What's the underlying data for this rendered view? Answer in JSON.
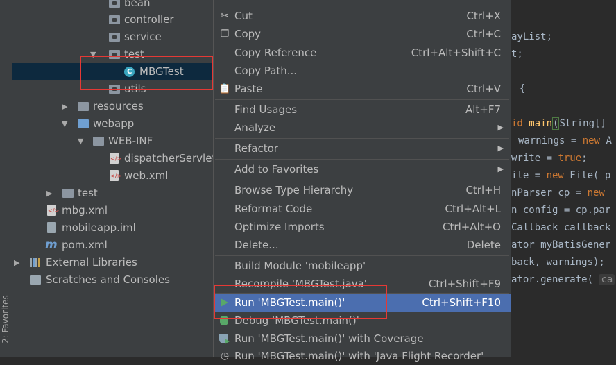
{
  "sidebar": {
    "favorites_label": "2: Favorites"
  },
  "tree": {
    "bean": "bean",
    "controller": "controller",
    "service": "service",
    "test": "test",
    "mbgtest": "MBGTest",
    "utils": "utils",
    "resources": "resources",
    "webapp": "webapp",
    "webinf": "WEB-INF",
    "dispatcher": "dispatcherServlet",
    "webxml": "web.xml",
    "test2": "test",
    "mbgxml": "mbg.xml",
    "iml": "mobileapp.iml",
    "pom": "pom.xml",
    "extlibs": "External Libraries",
    "scratches": "Scratches and Consoles"
  },
  "menu": {
    "cut": "Cut",
    "cut_sc": "Ctrl+X",
    "copy": "Copy",
    "copy_sc": "Ctrl+C",
    "copy_ref": "Copy Reference",
    "copy_ref_sc": "Ctrl+Alt+Shift+C",
    "copy_path": "Copy Path...",
    "paste": "Paste",
    "paste_sc": "Ctrl+V",
    "find_usages": "Find Usages",
    "find_usages_sc": "Alt+F7",
    "analyze": "Analyze",
    "refactor": "Refactor",
    "add_fav": "Add to Favorites",
    "browse_type": "Browse Type Hierarchy",
    "browse_type_sc": "Ctrl+H",
    "reformat": "Reformat Code",
    "reformat_sc": "Ctrl+Alt+L",
    "optimize": "Optimize Imports",
    "optimize_sc": "Ctrl+Alt+O",
    "delete": "Delete...",
    "delete_sc": "Delete",
    "build": "Build Module 'mobileapp'",
    "recompile": "Recompile 'MBGTest.java'",
    "recompile_sc": "Ctrl+Shift+F9",
    "run": "Run 'MBGTest.main()'",
    "run_sc": "Ctrl+Shift+F10",
    "debug": "Debug 'MBGTest.main()'",
    "coverage": "Run 'MBGTest.main()' with Coverage",
    "jfr": "Run 'MBGTest.main()' with 'Java Flight Recorder'"
  },
  "editor": {
    "l1": "ayList;",
    "l2": "t;",
    "l3": "{",
    "l4a": "id",
    "l4b": "main",
    "l4c": "(",
    "l4d": "String[]",
    "l5a": "warnings = ",
    "l5b": "new",
    "l5c": " A",
    "l6a": "write = ",
    "l6b": "true",
    "l6c": ";",
    "l7a": "ile = ",
    "l7b": "new",
    "l7c": " File( p",
    "l8a": "nParser cp = ",
    "l8b": "new",
    "l9": "n config = cp.par",
    "l10": "Callback callback",
    "l11": "ator myBatisGener",
    "l12": "back, warnings);",
    "l13a": "ator.generate( ",
    "l13b": "ca"
  }
}
